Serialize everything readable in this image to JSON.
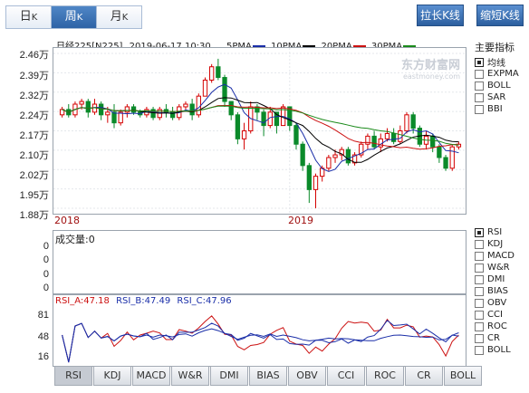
{
  "period_tabs": [
    {
      "label": "日",
      "sub": "K",
      "active": false
    },
    {
      "label": "周",
      "sub": "K",
      "active": true
    },
    {
      "label": "月",
      "sub": "K",
      "active": false
    }
  ],
  "toolbar": {
    "stretch_label": "拉长K线",
    "shrink_label": "缩短K线"
  },
  "header": {
    "symbol": "日经225[N225]",
    "datetime": "2019-06-17 10:30",
    "ma": [
      {
        "label": "5PMA",
        "color": "#1a2ea8"
      },
      {
        "label": "10PMA",
        "color": "#000000"
      },
      {
        "label": "20PMA",
        "color": "#cc1111"
      },
      {
        "label": "30PMA",
        "color": "#1a8a1a"
      }
    ]
  },
  "watermark": {
    "name": "东方财富网",
    "url": "eastmoney.com"
  },
  "price_axis": {
    "labels": [
      "2.46万",
      "2.39万",
      "2.32万",
      "2.24万",
      "2.17万",
      "2.10万",
      "2.02万",
      "1.95万",
      "1.88万"
    ],
    "min": 1.88,
    "max": 2.46,
    "unit": "万"
  },
  "year_labels": [
    "2018",
    "2019"
  ],
  "volume": {
    "title": "成交量:0",
    "ticks": [
      "0",
      "0",
      "0",
      "0"
    ]
  },
  "rsi": {
    "labels": [
      {
        "text": "RSI_A:47.18",
        "color": "#cc1111"
      },
      {
        "text": "RSI_B:47.49",
        "color": "#1a2ea8"
      },
      {
        "text": "RSI_C:47.96",
        "color": "#1a2ea8"
      }
    ],
    "ticks": [
      "81",
      "48",
      "16"
    ]
  },
  "side_indicators": {
    "title": "主要指标",
    "items": [
      {
        "label": "均线",
        "checked": true
      },
      {
        "label": "EXPMA",
        "checked": false
      },
      {
        "label": "BOLL",
        "checked": false
      },
      {
        "label": "SAR",
        "checked": false
      },
      {
        "label": "BBI",
        "checked": false
      }
    ]
  },
  "side_sub_indicators": [
    {
      "label": "RSI",
      "checked": true
    },
    {
      "label": "KDJ",
      "checked": false
    },
    {
      "label": "MACD",
      "checked": false
    },
    {
      "label": "W&R",
      "checked": false
    },
    {
      "label": "DMI",
      "checked": false
    },
    {
      "label": "BIAS",
      "checked": false
    },
    {
      "label": "OBV",
      "checked": false
    },
    {
      "label": "CCI",
      "checked": false
    },
    {
      "label": "ROC",
      "checked": false
    },
    {
      "label": "CR",
      "checked": false
    },
    {
      "label": "BOLL",
      "checked": false
    }
  ],
  "bottom_tabs": [
    {
      "label": "RSI",
      "active": true
    },
    {
      "label": "KDJ"
    },
    {
      "label": "MACD"
    },
    {
      "label": "W&R"
    },
    {
      "label": "DMI"
    },
    {
      "label": "BIAS"
    },
    {
      "label": "OBV"
    },
    {
      "label": "CCI"
    },
    {
      "label": "ROC"
    },
    {
      "label": "CR"
    },
    {
      "label": "BOLL"
    }
  ],
  "chart_data": {
    "type": "candlestick",
    "price_unit": "万",
    "ylim": [
      1.88,
      2.46
    ],
    "candles": [
      [
        2.23,
        2.25,
        2.22,
        2.26
      ],
      [
        2.25,
        2.23,
        2.22,
        2.27
      ],
      [
        2.23,
        2.27,
        2.22,
        2.28
      ],
      [
        2.27,
        2.28,
        2.25,
        2.29
      ],
      [
        2.28,
        2.24,
        2.22,
        2.29
      ],
      [
        2.24,
        2.27,
        2.23,
        2.29
      ],
      [
        2.27,
        2.23,
        2.21,
        2.28
      ],
      [
        2.23,
        2.24,
        2.2,
        2.26
      ],
      [
        2.24,
        2.2,
        2.18,
        2.27
      ],
      [
        2.2,
        2.24,
        2.19,
        2.25
      ],
      [
        2.24,
        2.26,
        2.22,
        2.27
      ],
      [
        2.26,
        2.24,
        2.23,
        2.27
      ],
      [
        2.24,
        2.23,
        2.22,
        2.25
      ],
      [
        2.23,
        2.25,
        2.22,
        2.26
      ],
      [
        2.25,
        2.22,
        2.21,
        2.26
      ],
      [
        2.22,
        2.25,
        2.21,
        2.26
      ],
      [
        2.25,
        2.24,
        2.22,
        2.27
      ],
      [
        2.24,
        2.22,
        2.21,
        2.26
      ],
      [
        2.22,
        2.26,
        2.21,
        2.27
      ],
      [
        2.26,
        2.27,
        2.25,
        2.28
      ],
      [
        2.27,
        2.23,
        2.21,
        2.29
      ],
      [
        2.23,
        2.3,
        2.22,
        2.31
      ],
      [
        2.3,
        2.36,
        2.3,
        2.37
      ],
      [
        2.36,
        2.41,
        2.35,
        2.42
      ],
      [
        2.41,
        2.37,
        2.36,
        2.44
      ],
      [
        2.37,
        2.28,
        2.26,
        2.38
      ],
      [
        2.28,
        2.23,
        2.21,
        2.28
      ],
      [
        2.23,
        2.14,
        2.12,
        2.24
      ],
      [
        2.14,
        2.17,
        2.1,
        2.2
      ],
      [
        2.17,
        2.26,
        2.16,
        2.28
      ],
      [
        2.26,
        2.24,
        2.21,
        2.27
      ],
      [
        2.24,
        2.19,
        2.15,
        2.25
      ],
      [
        2.19,
        2.24,
        2.18,
        2.26
      ],
      [
        2.24,
        2.19,
        2.16,
        2.24
      ],
      [
        2.19,
        2.26,
        2.19,
        2.27
      ],
      [
        2.26,
        2.19,
        2.17,
        2.26
      ],
      [
        2.19,
        2.12,
        2.1,
        2.2
      ],
      [
        2.12,
        2.04,
        2.02,
        2.13
      ],
      [
        2.04,
        1.95,
        1.9,
        2.05
      ],
      [
        1.95,
        2.0,
        1.88,
        2.01
      ],
      [
        2.0,
        2.03,
        1.98,
        2.04
      ],
      [
        2.03,
        2.07,
        2.02,
        2.08
      ],
      [
        2.07,
        2.08,
        2.05,
        2.1
      ],
      [
        2.08,
        2.1,
        2.06,
        2.11
      ],
      [
        2.1,
        2.05,
        2.04,
        2.11
      ],
      [
        2.05,
        2.08,
        2.04,
        2.09
      ],
      [
        2.08,
        2.12,
        2.07,
        2.13
      ],
      [
        2.12,
        2.15,
        2.1,
        2.16
      ],
      [
        2.15,
        2.11,
        2.1,
        2.17
      ],
      [
        2.11,
        2.14,
        2.09,
        2.16
      ],
      [
        2.14,
        2.16,
        2.13,
        2.18
      ],
      [
        2.16,
        2.13,
        2.12,
        2.18
      ],
      [
        2.13,
        2.17,
        2.12,
        2.19
      ],
      [
        2.17,
        2.23,
        2.16,
        2.24
      ],
      [
        2.23,
        2.18,
        2.16,
        2.24
      ],
      [
        2.18,
        2.12,
        2.11,
        2.19
      ],
      [
        2.12,
        2.15,
        2.1,
        2.17
      ],
      [
        2.15,
        2.11,
        2.09,
        2.16
      ],
      [
        2.11,
        2.07,
        2.05,
        2.12
      ],
      [
        2.07,
        2.03,
        2.02,
        2.08
      ],
      [
        2.03,
        2.11,
        2.02,
        2.12
      ],
      [
        2.11,
        2.12,
        2.1,
        2.13
      ]
    ],
    "rsi_ylim": [
      0,
      100
    ]
  }
}
